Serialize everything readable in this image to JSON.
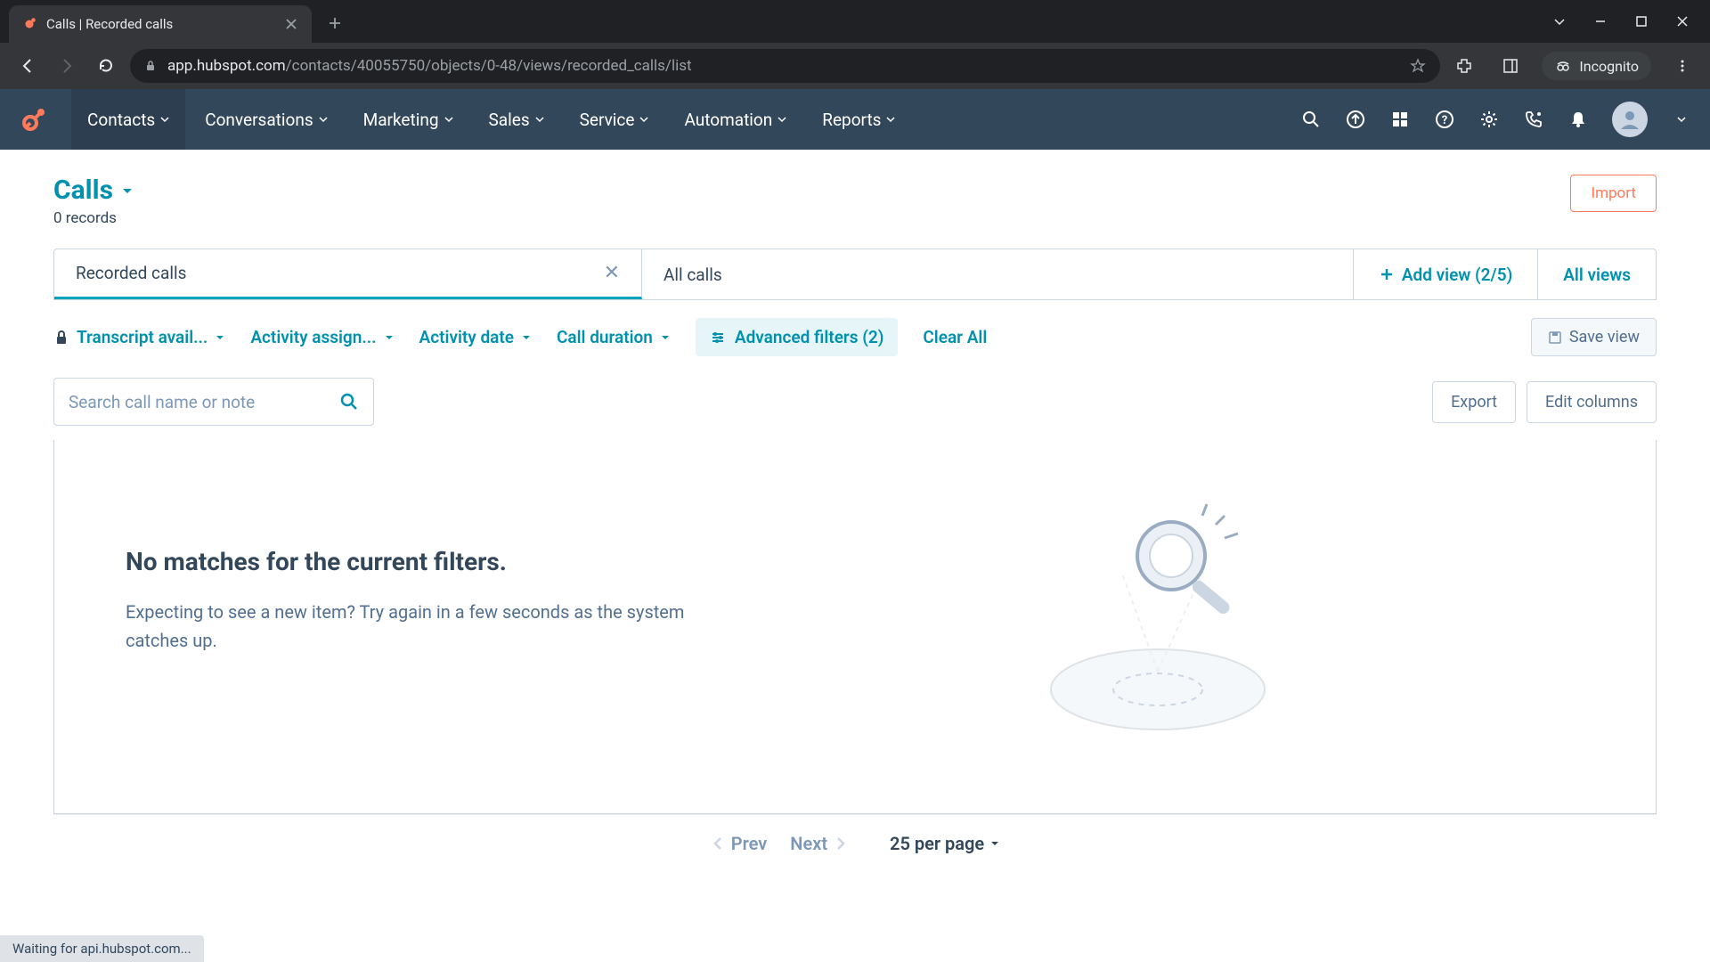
{
  "browser": {
    "tab_title": "Calls | Recorded calls",
    "url_host": "app.hubspot.com",
    "url_path": "/contacts/40055750/objects/0-48/views/recorded_calls/list",
    "incognito_label": "Incognito"
  },
  "nav": {
    "items": [
      "Contacts",
      "Conversations",
      "Marketing",
      "Sales",
      "Service",
      "Automation",
      "Reports"
    ],
    "active_index": 0
  },
  "page": {
    "title": "Calls",
    "records_text": "0 records",
    "import_label": "Import"
  },
  "views": {
    "tabs": [
      {
        "label": "Recorded calls",
        "closable": true,
        "active": true
      },
      {
        "label": "All calls",
        "closable": false,
        "active": false
      }
    ],
    "add_view_label": "Add view (2/5)",
    "all_views_label": "All views"
  },
  "filters": {
    "chips": [
      {
        "label": "Transcript avail...",
        "locked": true
      },
      {
        "label": "Activity assign...",
        "locked": false
      },
      {
        "label": "Activity date",
        "locked": false
      },
      {
        "label": "Call duration",
        "locked": false
      }
    ],
    "advanced_label": "Advanced filters (2)",
    "clear_label": "Clear All",
    "save_view_label": "Save view"
  },
  "table": {
    "search_placeholder": "Search call name or note",
    "export_label": "Export",
    "edit_columns_label": "Edit columns"
  },
  "empty": {
    "title": "No matches for the current filters.",
    "subtitle": "Expecting to see a new item? Try again in a few seconds as the system catches up."
  },
  "pager": {
    "prev": "Prev",
    "next": "Next",
    "per_page": "25 per page"
  },
  "status": "Waiting for api.hubspot.com..."
}
